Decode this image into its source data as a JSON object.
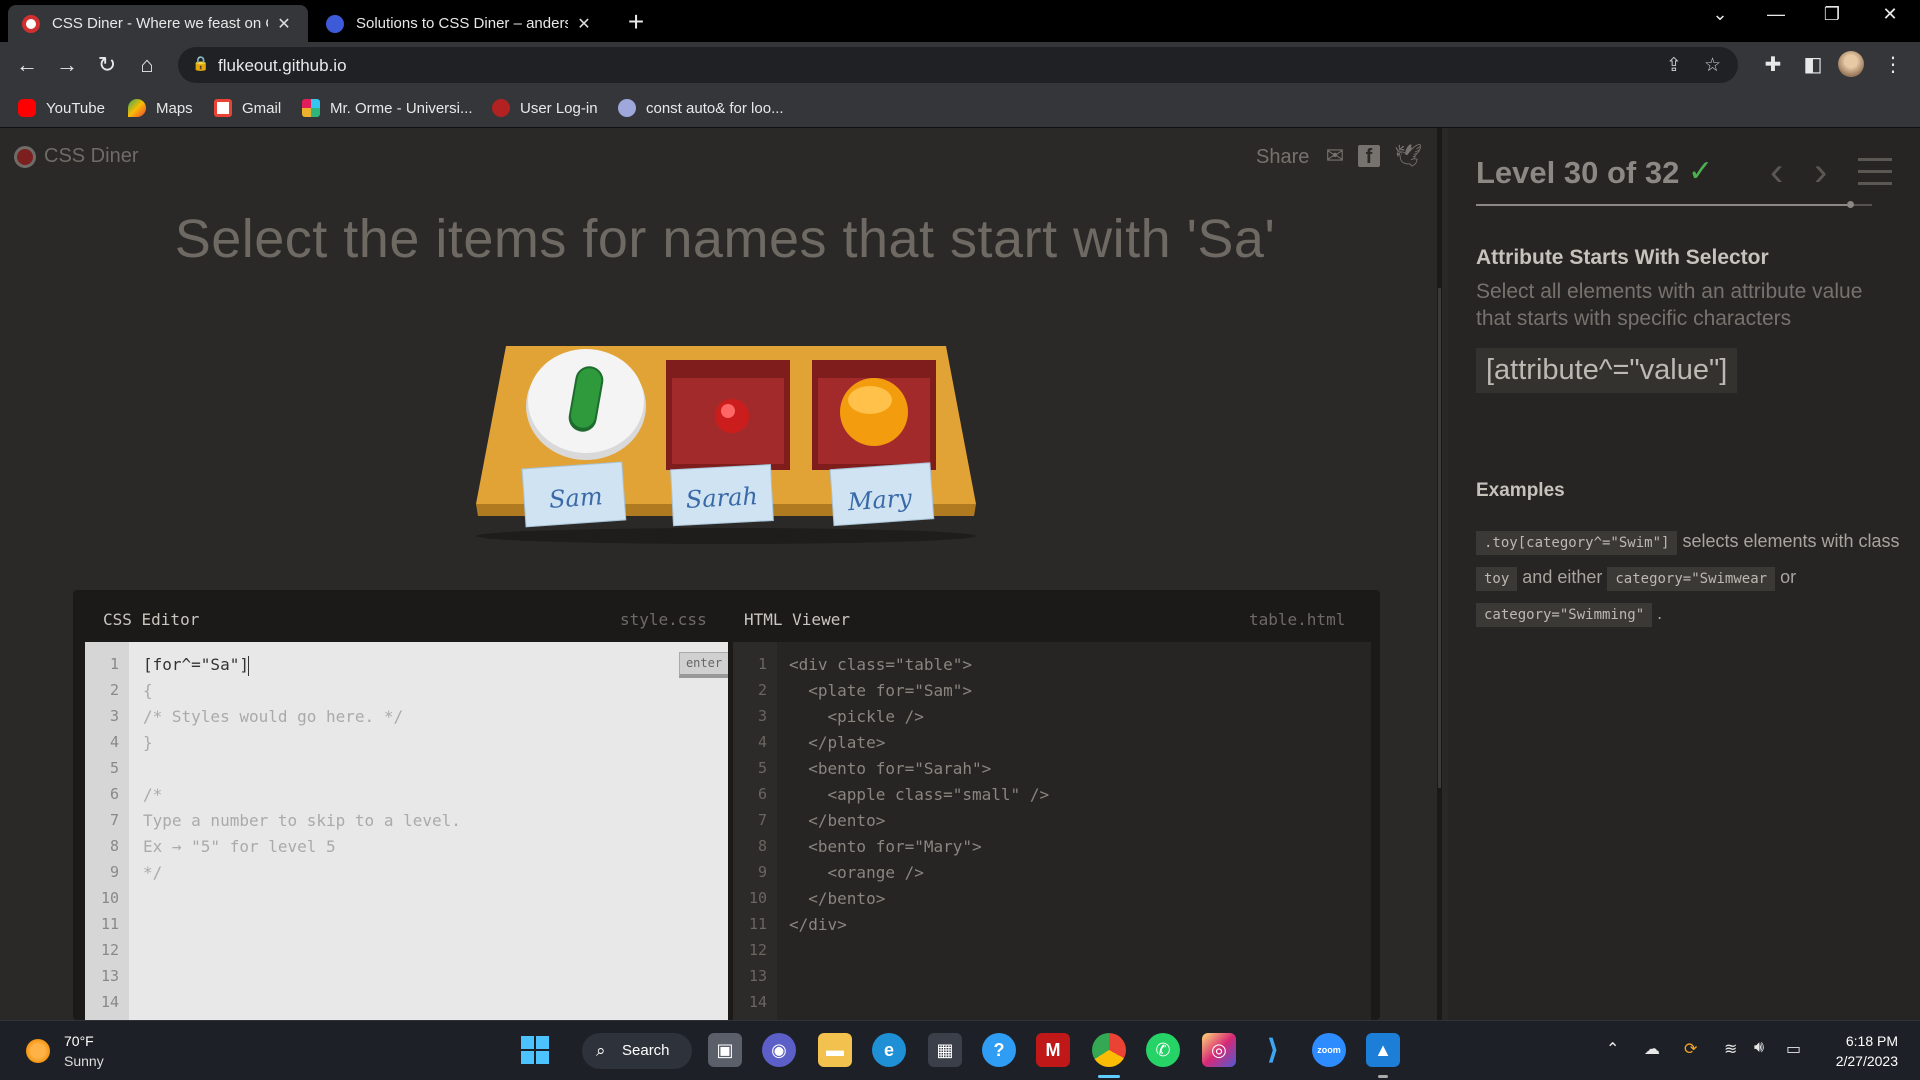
{
  "browser": {
    "tabs": [
      {
        "title": "CSS Diner - Where we feast on C",
        "active": true
      },
      {
        "title": "Solutions to CSS Diner – andersje",
        "active": false
      }
    ],
    "close_glyph": "✕",
    "new_tab_glyph": "+",
    "url": "flukeout.github.io",
    "bookmarks": [
      "YouTube",
      "Maps",
      "Gmail",
      "Mr. Orme - Universi...",
      "User Log-in",
      "const auto& for loo..."
    ]
  },
  "game": {
    "logo": "CSS Diner",
    "share": "Share",
    "instruction": "Select the items for names that start with 'Sa'",
    "plates": [
      "Sam",
      "Sarah",
      "Mary"
    ],
    "css_editor": {
      "title": "CSS Editor",
      "file": "style.css",
      "enter": "enter",
      "line_numbers": [
        "1",
        "2",
        "3",
        "4",
        "5",
        "6",
        "7",
        "8",
        "9",
        "10",
        "11",
        "12",
        "13",
        "14"
      ],
      "input": "[for^=\"Sa\"]",
      "lines": [
        "{",
        "/* Styles would go here. */",
        "}",
        "",
        "/*",
        "Type a number to skip to a level.",
        "Ex → \"5\" for level 5",
        "*/"
      ]
    },
    "html_viewer": {
      "title": "HTML Viewer",
      "file": "table.html",
      "line_numbers": [
        "1",
        "2",
        "3",
        "4",
        "5",
        "6",
        "7",
        "8",
        "9",
        "10",
        "11",
        "12",
        "13",
        "14"
      ],
      "lines": [
        "<div class=\"table\">",
        "  <plate for=\"Sam\">",
        "    <pickle />",
        "  </plate>",
        "  <bento for=\"Sarah\">",
        "    <apple class=\"small\" />",
        "  </bento>",
        "  <bento for=\"Mary\">",
        "    <orange />",
        "  </bento>",
        "</div>"
      ]
    }
  },
  "side": {
    "level": "Level 30 of 32",
    "check": "✓",
    "prev": "‹",
    "next": "›",
    "progress": 0.9375,
    "selector_name": "Attribute Starts With Selector",
    "selector_desc": "Select all elements with an attribute value that starts with specific characters",
    "syntax": "[attribute^=\"value\"]",
    "examples_title": "Examples",
    "example": {
      "code1": ".toy[category^=\"Swim\"]",
      "text1": " selects elements with class ",
      "code2": "toy",
      "text2": " and either ",
      "code3": "category=\"Swimwear",
      "text3": " or ",
      "code4": "category=\"Swimming\"",
      "text4": " ."
    }
  },
  "taskbar": {
    "temp": "70°F",
    "condition": "Sunny",
    "search": "Search",
    "time": "6:18 PM",
    "date": "2/27/2023"
  },
  "colors": {
    "accent_green": "#4cb050",
    "plate_wood": "#e2a336",
    "bento_red": "#a32a2a"
  }
}
